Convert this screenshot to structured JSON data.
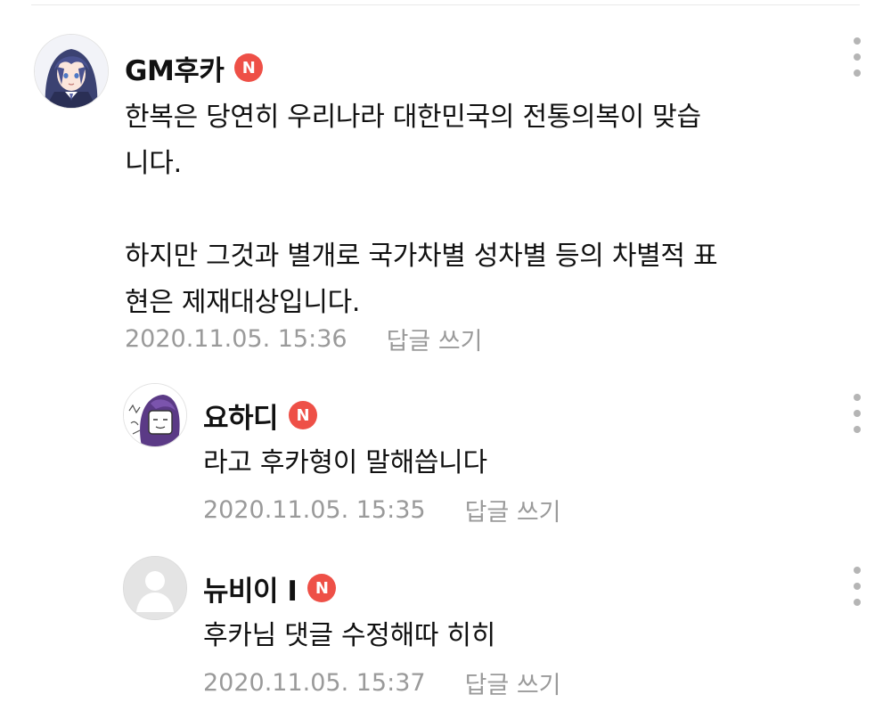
{
  "comments": [
    {
      "nickname": "GM후카",
      "badge": "N",
      "body": "한복은 당연히 우리나라 대한민국의 전통의복이 맞습\n니다.\n\n하지만 그것과 별개로 국가차별 성차별 등의 차별적 표\n현은 제재대상입니다.",
      "timestamp": "2020.11.05. 15:36",
      "reply_label": "답글 쓰기",
      "avatar_icon": "anime-avatar-icon"
    },
    {
      "nickname": "요하디",
      "badge": "N",
      "body": "라고 후카형이 말해씁니다",
      "timestamp": "2020.11.05. 15:35",
      "reply_label": "답글 쓰기",
      "avatar_icon": "sketch-avatar-icon"
    },
    {
      "nickname": "뉴비이 I",
      "badge": "N",
      "body": "후카님 댓글 수정해따 히히",
      "timestamp": "2020.11.05. 15:37",
      "reply_label": "답글 쓰기",
      "avatar_icon": "default-avatar-icon"
    }
  ],
  "colors": {
    "badge": "#ee5047",
    "meta_text": "#9a9a9a",
    "more_dots": "#b5b5b5"
  }
}
